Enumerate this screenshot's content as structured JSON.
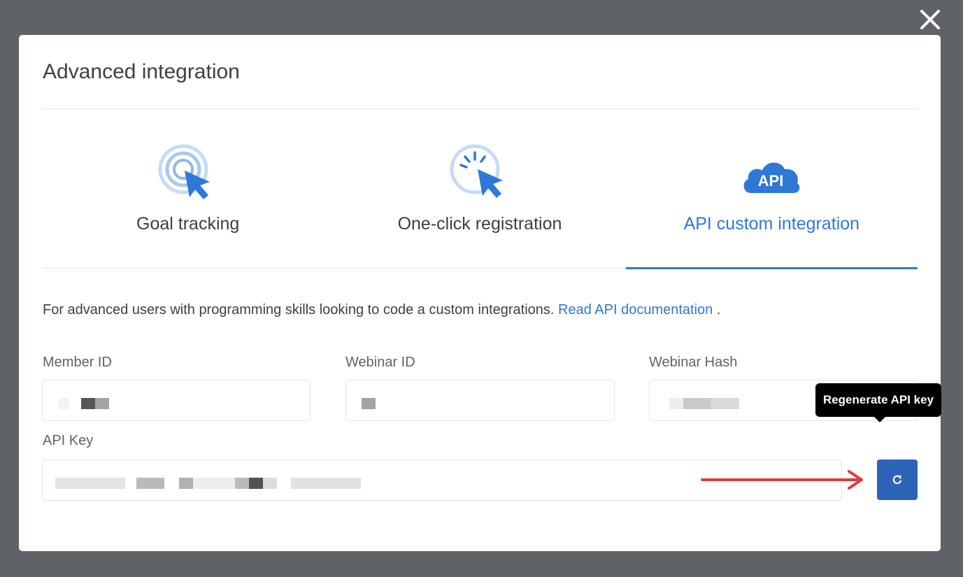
{
  "modal": {
    "title": "Advanced integration"
  },
  "tabs": [
    {
      "label": "Goal tracking",
      "icon": "target-cursor-icon",
      "active": false
    },
    {
      "label": "One-click registration",
      "icon": "click-cursor-icon",
      "active": false
    },
    {
      "label": "API custom integration",
      "icon": "api-cloud-icon",
      "active": true
    }
  ],
  "api_icon_text": "API",
  "description": {
    "text": "For advanced users with programming skills looking to code a custom integrations.",
    "link": "Read API documentation",
    "suffix": "."
  },
  "fields": {
    "member_id": {
      "label": "Member ID"
    },
    "webinar_id": {
      "label": "Webinar ID"
    },
    "webinar_hash": {
      "label": "Webinar Hash"
    },
    "api_key": {
      "label": "API Key"
    }
  },
  "tooltip": {
    "text": "Regenerate API key"
  },
  "colors": {
    "accent": "#2e78d6",
    "button": "#2e64b8",
    "arrow": "#e0393e",
    "overlay": "#5f6368"
  }
}
